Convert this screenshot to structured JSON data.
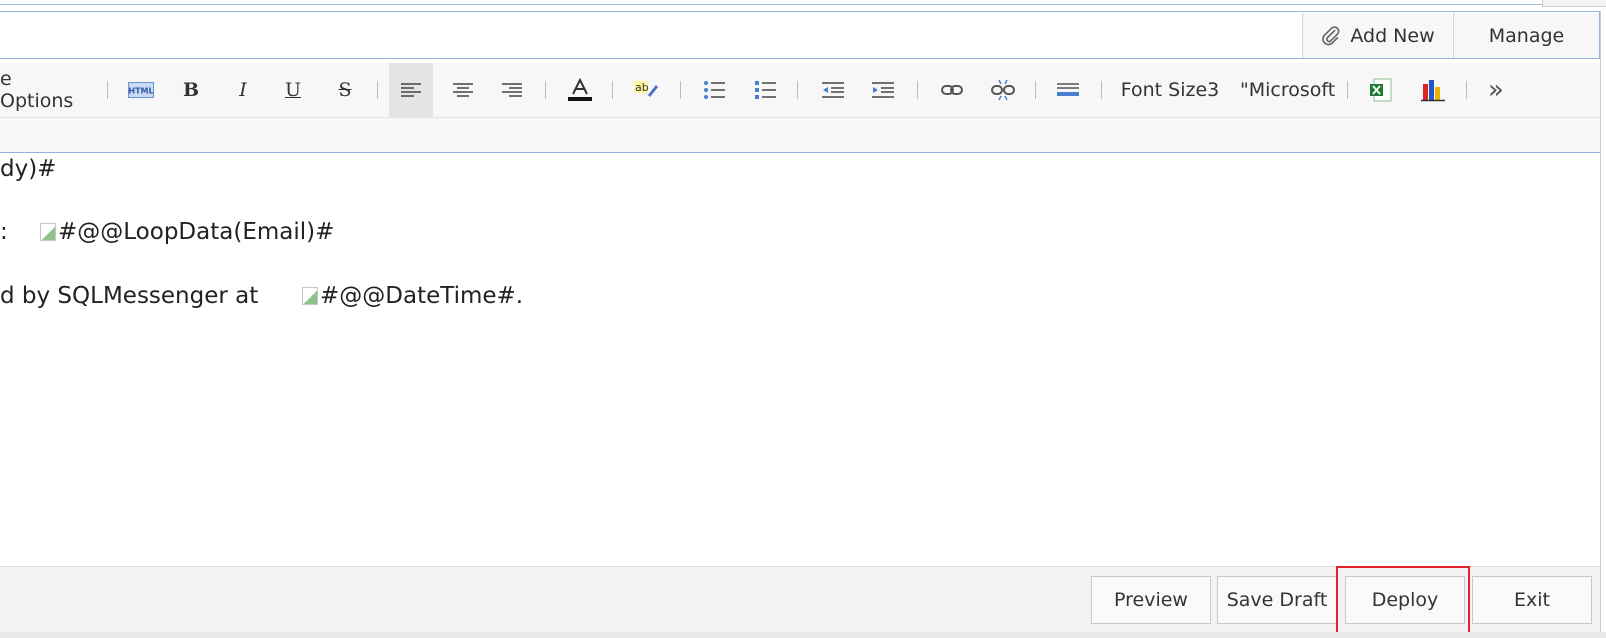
{
  "attachments": {
    "add_new_label": "Add New",
    "manage_label": "Manage"
  },
  "toolbar": {
    "page_options_label": "e Options",
    "html_label": "HTML",
    "bold_label": "B",
    "italic_label": "I",
    "underline_label": "U",
    "strike_label": "S",
    "font_size_label": "Font Size3",
    "font_family_label": "\"Microsoft",
    "more_label": "»",
    "highlight_label": "ab"
  },
  "content": {
    "line1": "dy)#",
    "line2_prefix": ":",
    "line2_token": "#@@LoopData(Email)#",
    "line3_prefix": "d by SQLMessenger at",
    "line3_token": "#@@DateTime#."
  },
  "footer": {
    "preview_label": "Preview",
    "save_draft_label": "Save Draft",
    "deploy_label": "Deploy",
    "exit_label": "Exit"
  },
  "colors": {
    "accent_border": "#8fb3dc",
    "highlight_red": "#e3242b",
    "excel_green": "#1e7b34"
  }
}
